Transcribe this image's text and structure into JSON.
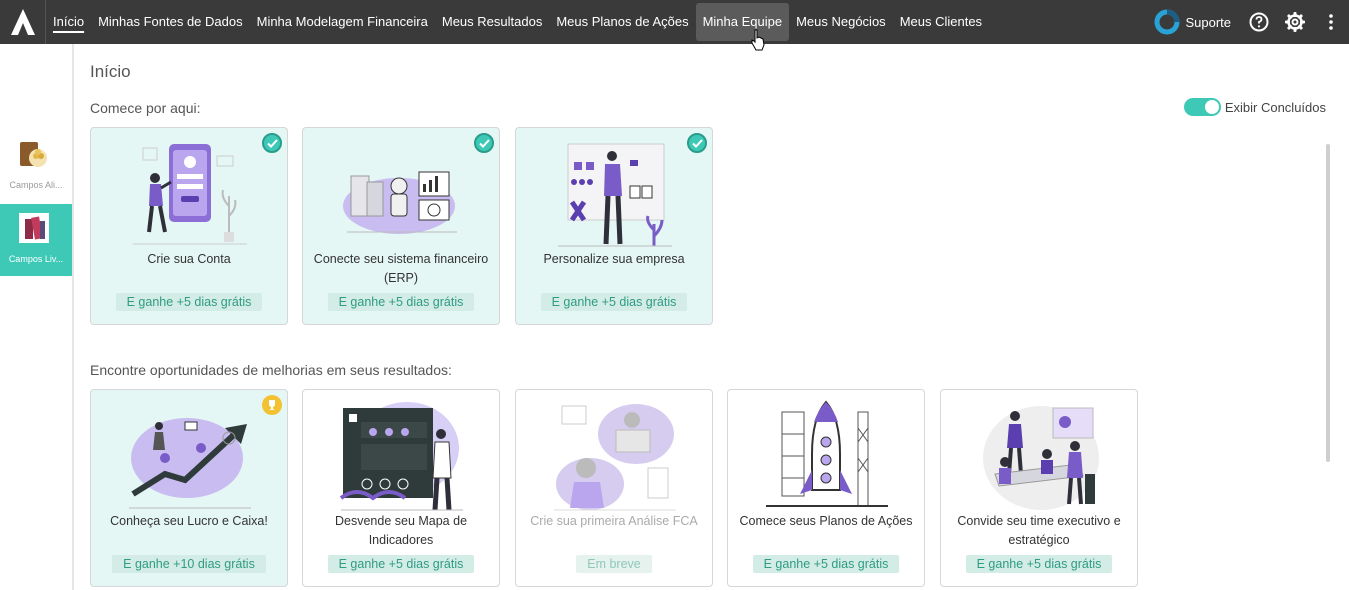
{
  "nav": {
    "items": [
      "Início",
      "Minhas Fontes de Dados",
      "Minha Modelagem Financeira",
      "Meus Resultados",
      "Meus Planos de Ações",
      "Minha Equipe",
      "Meus Negócios",
      "Meus Clientes"
    ],
    "active_index": 0,
    "hover_index": 5,
    "support_label": "Suporte",
    "icons": [
      "logo-a-icon",
      "support-ring-icon",
      "help-icon",
      "gear-icon",
      "more-vertical-icon"
    ]
  },
  "sidebar": {
    "items": [
      {
        "label": "Campos Ali...",
        "active": false
      },
      {
        "label": "Campos Liv...",
        "active": true
      }
    ]
  },
  "main": {
    "page_title": "Início",
    "section1_title": "Comece por aqui:",
    "toggle_label": "Exibir Concluídos",
    "section2_title": "Encontre oportunidades de melhorias em seus resultados:",
    "cards_row1": [
      {
        "title": "Crie sua Conta",
        "badge": "E ganhe +5 dias grátis",
        "status": "done"
      },
      {
        "title": "Conecte seu sistema financeiro (ERP)",
        "badge": "E ganhe +5 dias grátis",
        "status": "done"
      },
      {
        "title": "Personalize sua empresa",
        "badge": "E ganhe +5 dias grátis",
        "status": "done"
      }
    ],
    "cards_row2": [
      {
        "title": "Conheça seu Lucro e Caixa!",
        "badge": "E ganhe +10 dias grátis",
        "status": "featured"
      },
      {
        "title": "Desvende seu Mapa de Indicadores",
        "badge": "E ganhe +5 dias grátis",
        "status": "open"
      },
      {
        "title": "Crie sua primeira Análise FCA",
        "badge": "Em breve",
        "status": "disabled"
      },
      {
        "title": "Comece seus Planos de Ações",
        "badge": "E ganhe +5 dias grátis",
        "status": "open"
      },
      {
        "title": "Convide seu time executivo e estratégico",
        "badge": "E ganhe +5 dias grátis",
        "status": "open"
      }
    ]
  },
  "colors": {
    "topbar": "#3a3a3a",
    "accent": "#3ec9b7",
    "badge_text": "#2e9c83",
    "illustration_purple": "#7a5cc8",
    "trophy": "#f2c233"
  }
}
